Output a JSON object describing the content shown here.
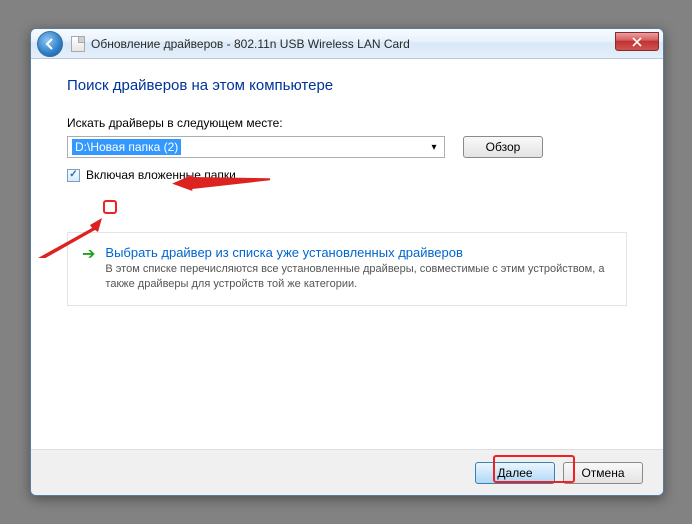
{
  "window": {
    "title": "Обновление драйверов - 802.11n USB Wireless LAN Card"
  },
  "heading": "Поиск драйверов на этом компьютере",
  "search_label": "Искать драйверы в следующем месте:",
  "path_value": "D:\\Новая папка (2)",
  "browse_label": "Обзор",
  "include_subfolders_label": "Включая вложенные папки",
  "include_subfolders_checked": true,
  "link_panel": {
    "title": "Выбрать драйвер из списка уже установленных драйверов",
    "description": "В этом списке перечисляются все установленные драйверы, совместимые с этим устройством, а также драйверы для устройств той же категории."
  },
  "footer": {
    "next_label": "Далее",
    "cancel_label": "Отмена"
  }
}
